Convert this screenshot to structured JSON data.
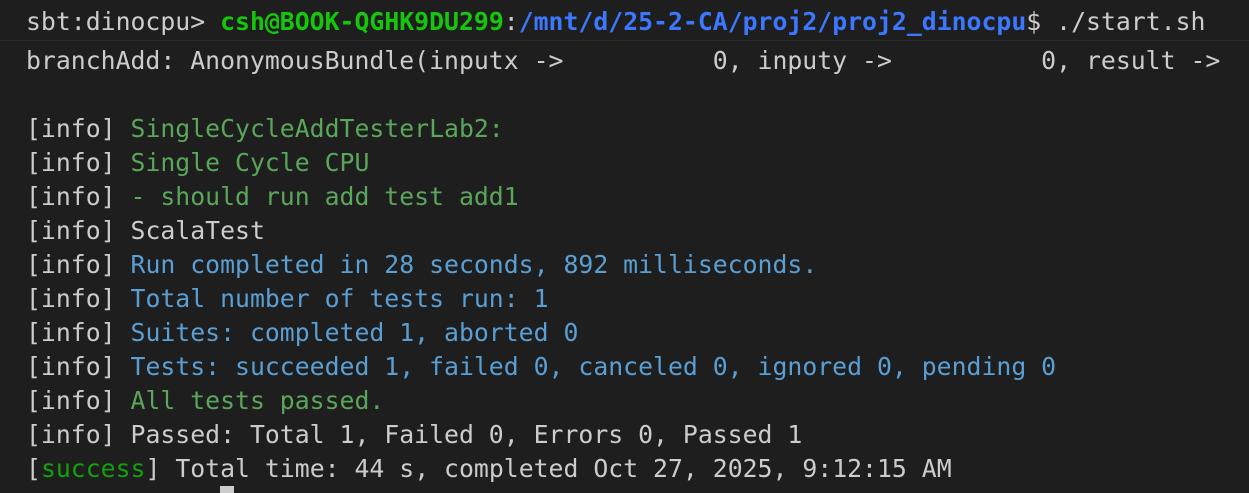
{
  "prompt": {
    "sbt_prefix": "sbt:dinocpu>",
    "user_host": "csh@BOOK-QGHK9DU299",
    "separator": ":",
    "path": "/mnt/d/25-2-CA/proj2/proj2_dinocpu",
    "symbol": "$",
    "command": "./start.sh"
  },
  "output": {
    "branch_line": "branchAdd: AnonymousBundle(inputx ->          0, inputy ->          0, result ->",
    "lines": [
      {
        "tag": "[info]",
        "text": "SingleCycleAddTesterLab2:"
      },
      {
        "tag": "[info]",
        "text": "Single Cycle CPU"
      },
      {
        "tag": "[info]",
        "text": "- should run add test add1"
      },
      {
        "tag": "[info]",
        "text": "ScalaTest"
      },
      {
        "tag": "[info]",
        "text": "Run completed in 28 seconds, 892 milliseconds."
      },
      {
        "tag": "[info]",
        "text": "Total number of tests run: 1"
      },
      {
        "tag": "[info]",
        "text": "Suites: completed 1, aborted 0"
      },
      {
        "tag": "[info]",
        "text": "Tests: succeeded 1, failed 0, canceled 0, ignored 0, pending 0"
      },
      {
        "tag": "[info]",
        "text": "All tests passed."
      },
      {
        "tag": "[info]",
        "text": "Passed: Total 1, Failed 0, Errors 0, Passed 1"
      }
    ],
    "success": {
      "open_bracket": "[",
      "word": "success",
      "close_bracket": "]",
      "text": "Total time: 44 s, completed Oct 27, 2025, 9:12:15 AM"
    }
  },
  "colors": {
    "background": "#1e1e1e",
    "prompt_user": "#16c60c",
    "prompt_path": "#3b78ff",
    "info_green": "#5aa65a",
    "info_blue": "#5a9fd4",
    "success_green": "#13a10e",
    "foreground": "#cccccc"
  }
}
